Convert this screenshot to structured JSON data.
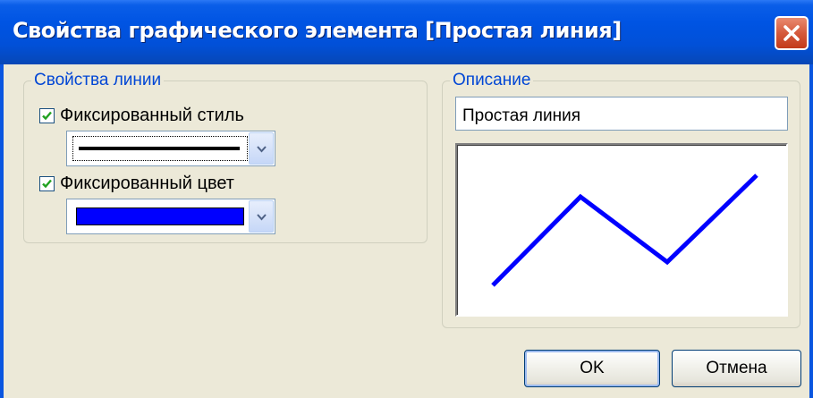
{
  "window": {
    "title": "Свойства графического элемента [Простая линия]"
  },
  "line_group": {
    "legend": "Свойства линии",
    "fixed_style": {
      "label": "Фиксированный стиль",
      "checked": true
    },
    "fixed_color": {
      "label": "Фиксированный цвет",
      "checked": true,
      "color": "#0000ff"
    }
  },
  "description_group": {
    "legend": "Описание",
    "value": "Простая линия"
  },
  "preview": {
    "line_color": "#0000ff"
  },
  "buttons": {
    "ok": "OK",
    "cancel": "Отмена"
  },
  "icons": {
    "close": "close-icon",
    "checkmark": "checkmark-icon",
    "dropdown": "chevron-down-icon"
  }
}
